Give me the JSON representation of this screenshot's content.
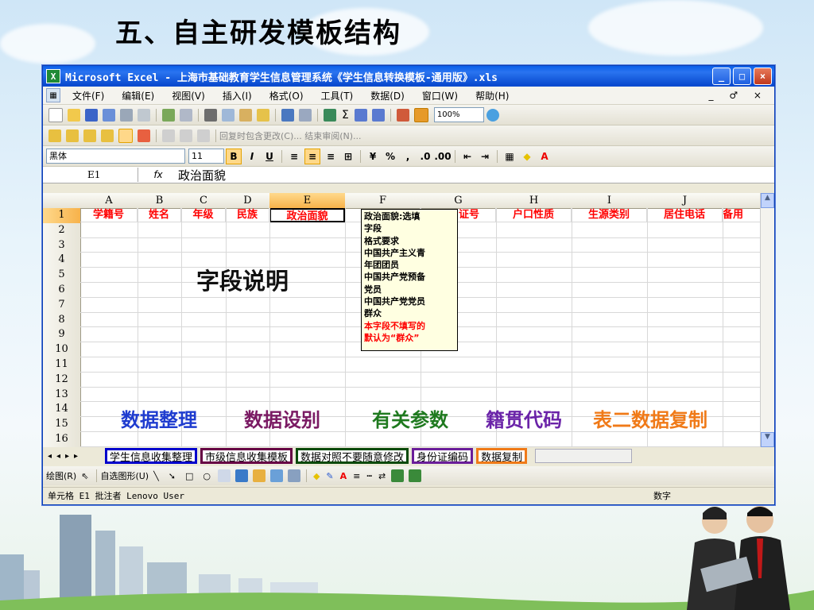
{
  "slide": {
    "title": "五、自主研发模板结构"
  },
  "window": {
    "title": "Microsoft Excel - 上海市基础教育学生信息管理系统《学生信息转换模板-通用版》.xls",
    "buttons": {
      "minimize": "_",
      "restore": "□",
      "close": "×"
    }
  },
  "menu": {
    "items": [
      "文件(F)",
      "编辑(E)",
      "视图(V)",
      "插入(I)",
      "格式(O)",
      "工具(T)",
      "数据(D)",
      "窗口(W)",
      "帮助(H)"
    ],
    "right_controls": "_ ♂ ×"
  },
  "toolbar": {
    "zoom": "100%",
    "reviewing": "回复时包含更改(C)...  结束审阅(N)..."
  },
  "format": {
    "font": "黑体",
    "size": "11",
    "bold": "B",
    "italic": "I",
    "underline": "U"
  },
  "formula": {
    "cell": "E1",
    "fx": "fx",
    "value": "政治面貌"
  },
  "grid": {
    "columns": [
      "A",
      "B",
      "C",
      "D",
      "E",
      "F",
      "G",
      "H",
      "I",
      "J"
    ],
    "rows": [
      "1",
      "2",
      "3",
      "4",
      "5",
      "6",
      "7",
      "8",
      "9",
      "10",
      "11",
      "12",
      "13",
      "14",
      "15",
      "16"
    ],
    "row1": [
      "学籍号",
      "姓名",
      "年级",
      "民族",
      "政治面貌",
      "",
      "证号",
      "户口性质",
      "生源类别",
      "居住电话",
      "备用"
    ]
  },
  "comment": {
    "lines": [
      "政治面貌:选填",
      "字段",
      "格式要求",
      "中国共产主义青",
      "年团团员",
      "中国共产党预备",
      "党员",
      "中国共产党党员",
      "群众"
    ],
    "red_lines": [
      "本字段不填写的",
      "默认为“群众”"
    ]
  },
  "annotations": {
    "field_desc": "字段说明",
    "labels": [
      {
        "text": "数据整理",
        "color": "#1f3ccf"
      },
      {
        "text": "数据设别",
        "color": "#7a1a63"
      },
      {
        "text": "有关参数",
        "color": "#1f7a1f"
      },
      {
        "text": "籍贯代码",
        "color": "#6a23a8"
      },
      {
        "text": "表二数据复制",
        "color": "#f07a18"
      }
    ]
  },
  "sheets": [
    {
      "label": "学生信息收集整理",
      "border": "#0000cc"
    },
    {
      "label": "市级信息收集模板",
      "border": "#660044"
    },
    {
      "label": "数据对照不要随意修改",
      "border": "#0a4a0a"
    },
    {
      "label": "身份证编码",
      "border": "#6a1e9a"
    },
    {
      "label": "数据复制",
      "border": "#f07a18"
    }
  ],
  "drawing": {
    "draw": "绘图(R)",
    "autoshapes": "自选图形(U)"
  },
  "status": {
    "text": "单元格 E1 批注者 Lenovo User",
    "mode": "数字"
  }
}
